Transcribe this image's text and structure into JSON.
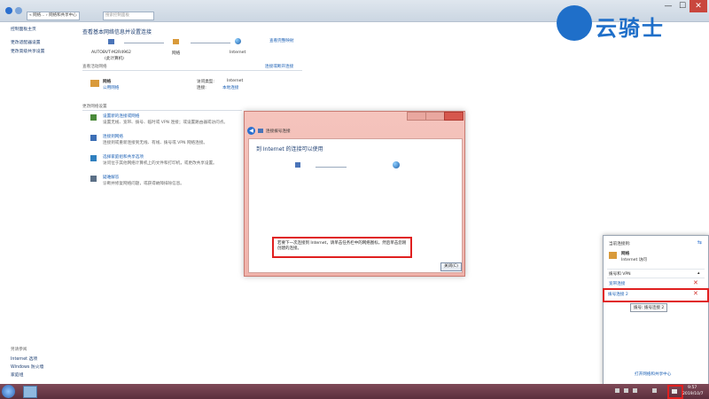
{
  "window": {
    "breadcrumb": "« 网络... › 网络和共享中心",
    "search_placeholder": "搜索控制面板",
    "controls": [
      "—",
      "☐",
      "✕"
    ]
  },
  "sidebar": {
    "items": [
      "控制面板主页",
      "更改适配器设置",
      "更改高级共享设置"
    ],
    "see_also_title": "另请参阅",
    "see_also": [
      "Internet 选项",
      "Windows 防火墙",
      "家庭组"
    ]
  },
  "main": {
    "title": "查看基本网络信息并设置连接",
    "view_full_map": "查看完整映射",
    "nodes": [
      {
        "name": "AUTOBVT-M2R4962",
        "sub": "(此计算机)"
      },
      {
        "name": "网络",
        "sub": ""
      },
      {
        "name": "Internet",
        "sub": ""
      }
    ],
    "active_networks_label": "查看活动网络",
    "connect_disconnect": "连接或断开连接",
    "network_name": "网络",
    "network_type": "公用网络",
    "access_type_label": "访问类型:",
    "access_type_value": "Internet",
    "connection_label": "连接:",
    "connection_value": "本地连接",
    "change_settings_label": "更改网络设置",
    "tasks": [
      {
        "title": "设置新的连接或网络",
        "desc": "设置无线、宽带、拨号、临时或 VPN 连接；或设置路由器或访问点。"
      },
      {
        "title": "连接到网络",
        "desc": "连接到或重新连接到无线、有线、拨号或 VPN 网络连接。"
      },
      {
        "title": "选择家庭组和共享选项",
        "desc": "访问位于其他网络计算机上的文件和打印机，或更改共享设置。"
      },
      {
        "title": "疑难解答",
        "desc": "诊断并修复网络问题，或获得故障排除信息。"
      }
    ]
  },
  "dialog": {
    "title": "连接拨号连接",
    "heading": "到 Internet 的连接可以使用",
    "message": "若要下一次连接到 Internet，请单击任务栏中的网络图标，然后单击您刚创建的连接。",
    "close_button": "关闭(C)"
  },
  "popup": {
    "header": "当前连接到:",
    "network_name": "网络",
    "network_status": "Internet 访问",
    "section": "拨号和 VPN",
    "items": [
      "宽带连接",
      "拨号连接 2"
    ],
    "tooltip": "拨号连接 2",
    "tooltip_prefix": "拨号",
    "footer_link": "打开网络和共享中心"
  },
  "taskbar": {
    "time": "9:57",
    "date": "2019/10/7"
  },
  "watermark": {
    "text": "云骑士"
  },
  "colors": {
    "highlight": "#e02020",
    "link": "#1a5fb4",
    "taskbar": "#6a3a48"
  }
}
